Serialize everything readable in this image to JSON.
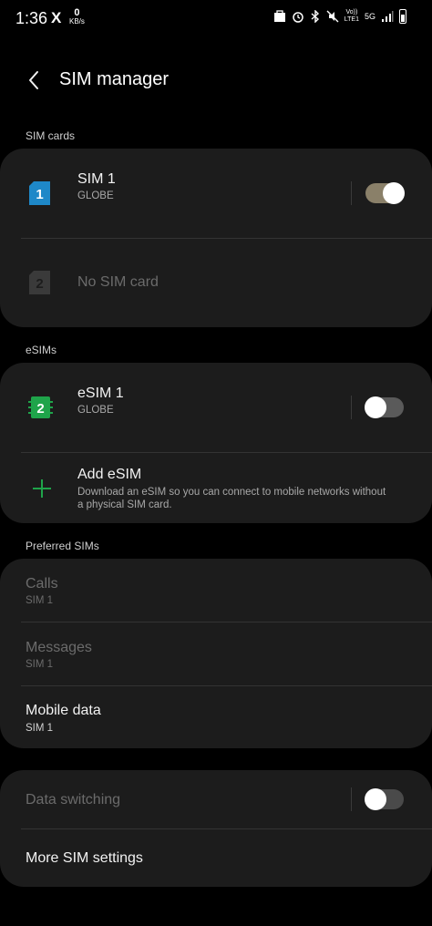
{
  "status_bar": {
    "time": "1:36",
    "x_logo": "X",
    "net_speed_value": "0",
    "net_speed_unit": "KB/s",
    "volte_top": "Vo))",
    "volte_bottom": "LTE1",
    "network": "5G"
  },
  "header": {
    "title": "SIM manager"
  },
  "sim_cards": {
    "label": "SIM cards",
    "sim1": {
      "number": "1",
      "name": "SIM 1",
      "carrier": "GLOBE",
      "enabled": true
    },
    "sim2": {
      "number": "2",
      "name": "No SIM card"
    }
  },
  "esims": {
    "label": "eSIMs",
    "esim1": {
      "number": "2",
      "name": "eSIM 1",
      "carrier": "GLOBE",
      "enabled": false
    },
    "add": {
      "title": "Add eSIM",
      "desc_line1": "Download an eSIM so you can connect to mobile networks without",
      "desc_line2": "a physical SIM card."
    }
  },
  "preferred": {
    "label": "Preferred SIMs",
    "calls": {
      "title": "Calls",
      "value": "SIM 1"
    },
    "messages": {
      "title": "Messages",
      "value": "SIM 1"
    },
    "mobile_data": {
      "title": "Mobile data",
      "value": "SIM 1"
    }
  },
  "other": {
    "data_switching": {
      "title": "Data switching",
      "enabled": false
    },
    "more_settings": {
      "title": "More SIM settings"
    }
  },
  "colors": {
    "background": "#000000",
    "card": "#1c1c1c",
    "sim1_blue": "#1e88c8",
    "esim_green": "#1fa44a",
    "toggle_on": "#8a8069",
    "plus_green": "#1fa44a"
  }
}
